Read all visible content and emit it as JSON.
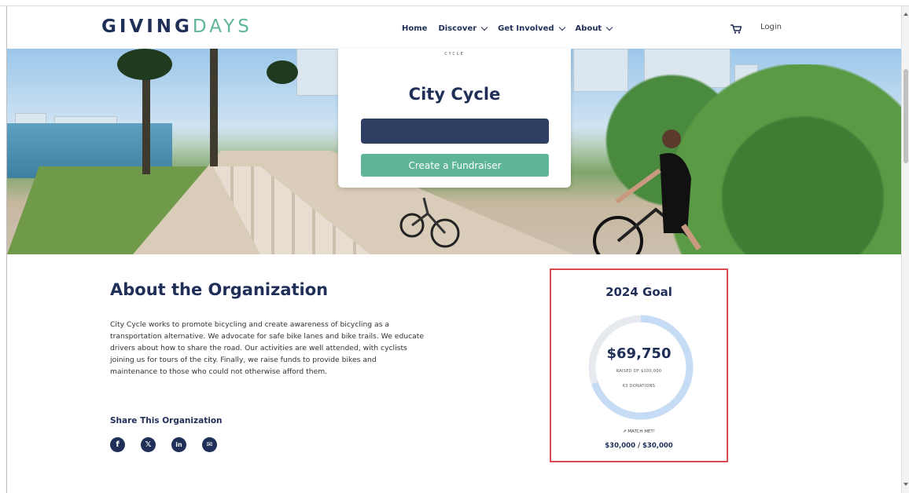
{
  "header": {
    "logo_part1": "GIVING",
    "logo_part2": "DAYS",
    "nav": [
      {
        "label": "Home"
      },
      {
        "label": "Discover"
      },
      {
        "label": "Get Involved"
      },
      {
        "label": "About"
      }
    ],
    "login_label": "Login",
    "cart_icon": "cart-icon"
  },
  "hero_card": {
    "eyebrow": "CYCLE",
    "title": "City Cycle",
    "primary_button_label": "",
    "create_fundraiser_label": "Create a Fundraiser"
  },
  "about": {
    "title": "About the Organization",
    "body": "City Cycle works to promote bicycling and create awareness of bicycling as a transportation alternative. We advocate for safe bike lanes and bike trails. We educate drivers about how to share the road. Our activities are well attended, with cyclists joining us for tours of the city. Finally, we raise funds to provide bikes and maintenance to those who could not otherwise afford them.",
    "share_title": "Share This Organization",
    "socials": [
      {
        "name": "facebook-icon",
        "glyph": "f"
      },
      {
        "name": "x-icon",
        "glyph": "𝕏"
      },
      {
        "name": "linkedin-icon",
        "glyph": "in"
      },
      {
        "name": "email-icon",
        "glyph": "✉"
      }
    ]
  },
  "goal": {
    "title": "2024 Goal",
    "amount": "$69,750",
    "raised_of": "RAISED OF $100,000",
    "donations": "63 DONATIONS",
    "progress_fraction": 0.6975,
    "match_label": "MATCH MET!",
    "match_amount": "$30,000 / $30,000"
  },
  "colors": {
    "navy": "#1f2f57",
    "green": "#5fb597",
    "ring_fill": "#c6dcf5",
    "ring_track": "#e6e9ee",
    "goal_border": "#d94a4f"
  }
}
